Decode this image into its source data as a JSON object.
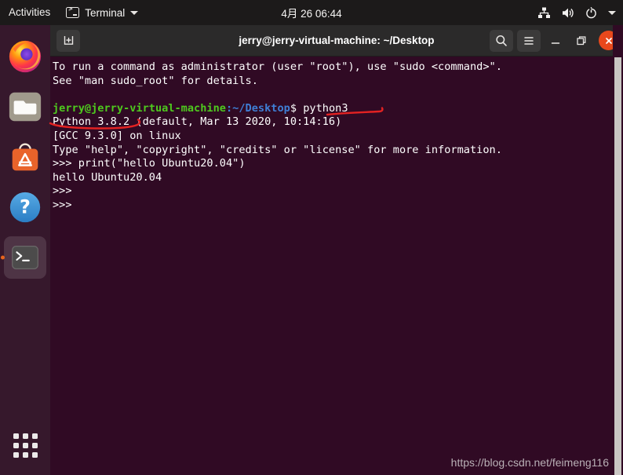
{
  "topbar": {
    "activities": "Activities",
    "app_name": "Terminal",
    "app_icon": "terminal-icon",
    "app_menu_caret": "chevron-down-icon",
    "clock": "4月 26  06:44",
    "tray": [
      {
        "name": "network-wired-icon"
      },
      {
        "name": "volume-icon"
      },
      {
        "name": "power-icon"
      },
      {
        "name": "chevron-down-icon"
      }
    ]
  },
  "dock": {
    "items": [
      {
        "name": "firefox-icon",
        "label": "Firefox",
        "active": false,
        "running": false
      },
      {
        "name": "files-icon",
        "label": "Files",
        "active": false,
        "running": false
      },
      {
        "name": "software-icon",
        "label": "Ubuntu Software",
        "active": false,
        "running": false
      },
      {
        "name": "help-icon",
        "label": "Help",
        "active": false,
        "running": false
      },
      {
        "name": "terminal-icon",
        "label": "Terminal",
        "active": true,
        "running": true
      }
    ],
    "show_applications_label": "Show Applications"
  },
  "window": {
    "new_tab_label": "New Tab",
    "title": "jerry@jerry-virtual-machine: ~/Desktop",
    "search_label": "Search",
    "menu_label": "Menu",
    "minimize_label": "Minimize",
    "maximize_label": "Restore",
    "close_label": "Close"
  },
  "terminal": {
    "lines": [
      {
        "segments": [
          {
            "text": "To run a command as administrator (user \"root\"), use \"sudo <command>\".",
            "color": "white"
          }
        ]
      },
      {
        "segments": [
          {
            "text": "See \"man sudo_root\" for details.",
            "color": "white"
          }
        ]
      },
      {
        "segments": [
          {
            "text": "",
            "color": "white"
          }
        ]
      },
      {
        "segments": [
          {
            "text": "jerry@jerry-virtual-machine",
            "color": "green"
          },
          {
            "text": ":",
            "color": "blue"
          },
          {
            "text": "~/Desktop",
            "color": "blue"
          },
          {
            "text": "$ python3",
            "color": "white"
          }
        ]
      },
      {
        "segments": [
          {
            "text": "Python 3.8.2 (default, Mar 13 2020, 10:14:16)",
            "color": "white"
          }
        ]
      },
      {
        "segments": [
          {
            "text": "[GCC 9.3.0] on linux",
            "color": "white"
          }
        ]
      },
      {
        "segments": [
          {
            "text": "Type \"help\", \"copyright\", \"credits\" or \"license\" for more information.",
            "color": "white"
          }
        ]
      },
      {
        "segments": [
          {
            "text": ">>> print(\"hello Ubuntu20.04\")",
            "color": "white"
          }
        ]
      },
      {
        "segments": [
          {
            "text": "hello Ubuntu20.04",
            "color": "white"
          }
        ]
      },
      {
        "segments": [
          {
            "text": ">>>",
            "color": "white"
          }
        ]
      },
      {
        "segments": [
          {
            "text": ">>>",
            "color": "white"
          }
        ]
      }
    ]
  },
  "annotations": {
    "color": "#e32222",
    "marks": [
      {
        "name": "underline-python3-command",
        "target": "python3"
      },
      {
        "name": "underline-python-version",
        "target": "Python 3.8.2"
      }
    ]
  },
  "watermark": "https://blog.csdn.net/feimeng116",
  "colors": {
    "terminal_bg": "#300a24",
    "titlebar_bg": "#2b2a2a",
    "topbar_bg": "#1c1a1a",
    "close_button": "#e8481c",
    "prompt_green": "#4ec91e",
    "prompt_blue": "#3f7fd6",
    "annotation_red": "#e32222",
    "running_dot": "#e8641c"
  }
}
